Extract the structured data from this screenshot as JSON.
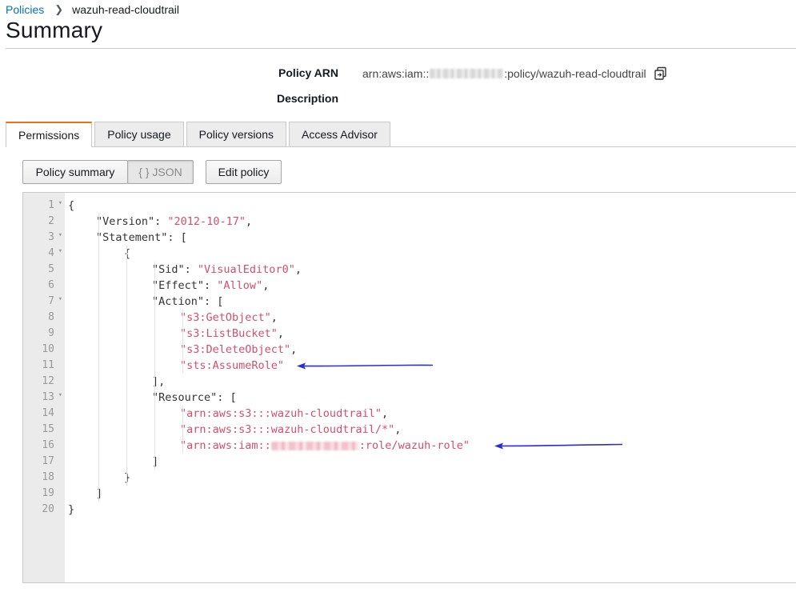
{
  "breadcrumb": {
    "parent": "Policies",
    "current": "wazuh-read-cloudtrail"
  },
  "page_title": "Summary",
  "meta": {
    "arn_label": "Policy ARN",
    "arn_prefix": "arn:aws:iam::",
    "arn_suffix": ":policy/wazuh-read-cloudtrail",
    "description_label": "Description"
  },
  "tabs": [
    "Permissions",
    "Policy usage",
    "Policy versions",
    "Access Advisor"
  ],
  "buttons": {
    "policy_summary": "Policy summary",
    "json": "{ } JSON",
    "edit_policy": "Edit policy"
  },
  "colors": {
    "accent_tab": "#ec7211",
    "link": "#0073bb",
    "string": "#d14f6b",
    "arrow": "#2b2bd6"
  },
  "code_lines": [
    {
      "num": "1",
      "fold": true,
      "indent": 0,
      "key": "",
      "value": "",
      "text": "{"
    },
    {
      "num": "2",
      "fold": false,
      "indent": 1,
      "key": "Version",
      "value": "2012-10-17",
      "text": ","
    },
    {
      "num": "3",
      "fold": true,
      "indent": 1,
      "key": "Statement",
      "value": "",
      "text": ": ["
    },
    {
      "num": "4",
      "fold": true,
      "indent": 2,
      "key": "",
      "value": "",
      "text": "{"
    },
    {
      "num": "5",
      "fold": false,
      "indent": 3,
      "key": "Sid",
      "value": "VisualEditor0",
      "text": ","
    },
    {
      "num": "6",
      "fold": false,
      "indent": 3,
      "key": "Effect",
      "value": "Allow",
      "text": ","
    },
    {
      "num": "7",
      "fold": true,
      "indent": 3,
      "key": "Action",
      "value": "",
      "text": ": ["
    },
    {
      "num": "8",
      "fold": false,
      "indent": 4,
      "key": "",
      "value": "s3:GetObject",
      "text": ","
    },
    {
      "num": "9",
      "fold": false,
      "indent": 4,
      "key": "",
      "value": "s3:ListBucket",
      "text": ","
    },
    {
      "num": "10",
      "fold": false,
      "indent": 4,
      "key": "",
      "value": "s3:DeleteObject",
      "text": ","
    },
    {
      "num": "11",
      "fold": false,
      "indent": 4,
      "key": "",
      "value": "sts:AssumeRole",
      "text": ""
    },
    {
      "num": "12",
      "fold": false,
      "indent": 3,
      "key": "",
      "value": "",
      "text": "],"
    },
    {
      "num": "13",
      "fold": true,
      "indent": 3,
      "key": "Resource",
      "value": "",
      "text": ": ["
    },
    {
      "num": "14",
      "fold": false,
      "indent": 4,
      "key": "",
      "value": "arn:aws:s3:::wazuh-cloudtrail",
      "text": ","
    },
    {
      "num": "15",
      "fold": false,
      "indent": 4,
      "key": "",
      "value": "arn:aws:s3:::wazuh-cloudtrail/*",
      "text": ","
    },
    {
      "num": "16",
      "fold": false,
      "indent": 4,
      "key": "",
      "value": "arn:aws:iam::",
      "value_suffix": ":role/wazuh-role",
      "redacted": true,
      "text": ""
    },
    {
      "num": "17",
      "fold": false,
      "indent": 3,
      "key": "",
      "value": "",
      "text": "]"
    },
    {
      "num": "18",
      "fold": false,
      "indent": 2,
      "key": "",
      "value": "",
      "text": "}"
    },
    {
      "num": "19",
      "fold": false,
      "indent": 1,
      "key": "",
      "value": "",
      "text": "]"
    },
    {
      "num": "20",
      "fold": false,
      "indent": 0,
      "key": "",
      "value": "",
      "text": "}"
    }
  ]
}
